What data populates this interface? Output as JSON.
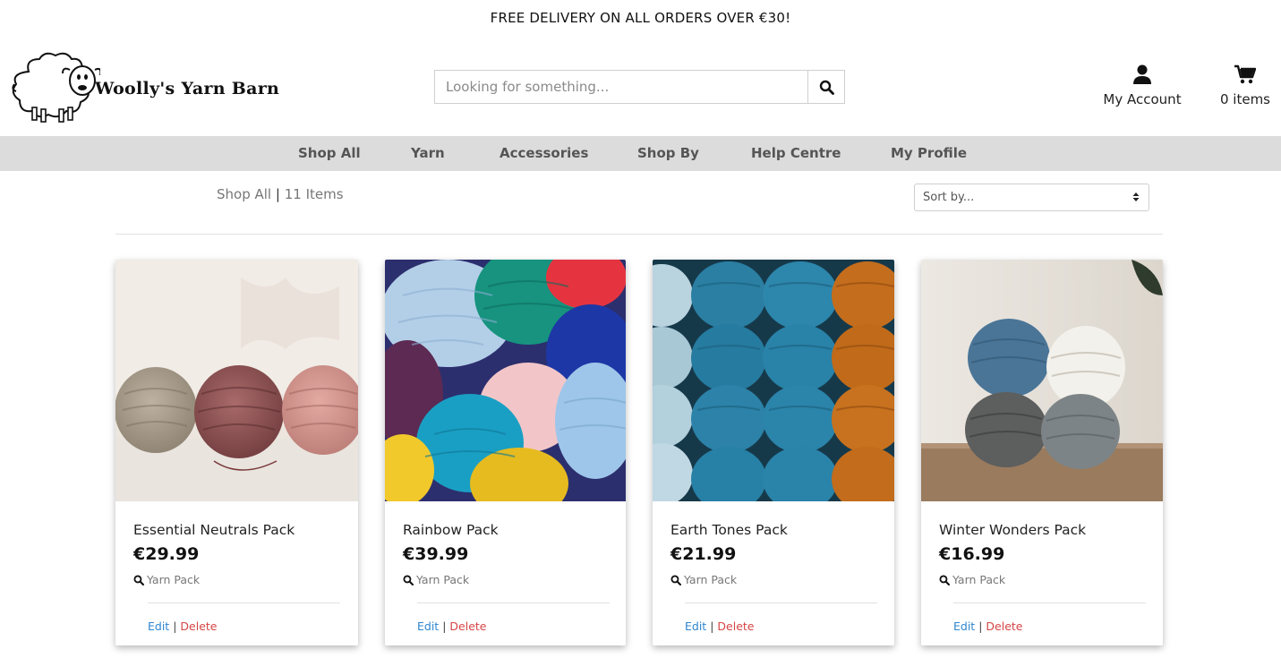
{
  "banner": {
    "text": "FREE DELIVERY ON ALL ORDERS OVER €30!"
  },
  "brand": {
    "name": "Woolly's Yarn Barn"
  },
  "search": {
    "placeholder": "Looking for something..."
  },
  "header": {
    "account_label": "My Account",
    "cart_label": "0 items"
  },
  "nav": {
    "items": [
      "Shop All",
      "Yarn",
      "Accessories",
      "Shop By",
      "Help Centre",
      "My Profile"
    ]
  },
  "breadcrumb": {
    "section": "Shop All",
    "separator": "|",
    "count": "11 Items"
  },
  "sort": {
    "selected": "Sort by..."
  },
  "products": [
    {
      "title": "Essential Neutrals Pack",
      "price": "€29.99",
      "category": "Yarn Pack",
      "edit": "Edit",
      "delete": "Delete"
    },
    {
      "title": "Rainbow Pack",
      "price": "€39.99",
      "category": "Yarn Pack",
      "edit": "Edit",
      "delete": "Delete"
    },
    {
      "title": "Earth Tones Pack",
      "price": "€21.99",
      "category": "Yarn Pack",
      "edit": "Edit",
      "delete": "Delete"
    },
    {
      "title": "Winter Wonders Pack",
      "price": "€16.99",
      "category": "Yarn Pack",
      "edit": "Edit",
      "delete": "Delete"
    }
  ],
  "colors": {
    "nav_bg": "#dcdcdc",
    "edit_link": "#2e86d0",
    "delete_link": "#d64545"
  },
  "icons": {
    "search": "search-icon",
    "account": "user-icon",
    "cart": "cart-icon",
    "sort": "sort-caret-icon",
    "category": "search-icon"
  }
}
